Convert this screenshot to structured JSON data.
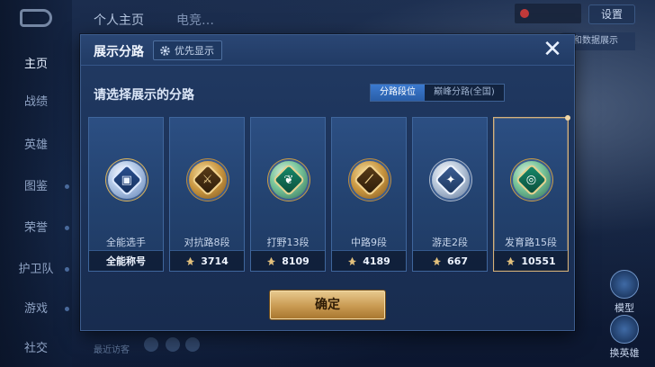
{
  "background": {
    "nav": {
      "items": [
        {
          "label": "主页",
          "active": true
        },
        {
          "label": "战绩",
          "active": false
        },
        {
          "label": "英雄",
          "active": false
        },
        {
          "label": "图鉴",
          "active": false
        },
        {
          "label": "荣誉",
          "active": false
        },
        {
          "label": "护卫队",
          "active": false
        },
        {
          "label": "游戏",
          "active": false
        },
        {
          "label": "社交",
          "active": false
        }
      ]
    },
    "top_tabs": [
      "个人主页",
      "电竞…"
    ],
    "settings_label": "设置",
    "data_tag": "和数据展示",
    "model_label": "模型",
    "switch_hero_label": "换英雄",
    "bottom_hint": "最近访客"
  },
  "modal": {
    "title": "展示分路",
    "priority_label": "优先显示",
    "close_glyph": "✕",
    "prompt": "请选择展示的分路",
    "segments": [
      {
        "label": "分路段位",
        "active": true
      },
      {
        "label": "巅峰分路(全国)",
        "active": false
      }
    ],
    "cards": [
      {
        "name": "全能选手",
        "footer": "全能称号",
        "emblem": "all-round-emblem-icon",
        "style": "blue",
        "glyph": "▣",
        "show_power": false,
        "selected": false
      },
      {
        "name": "对抗路8段",
        "footer": "3714",
        "emblem": "clash-lane-emblem-icon",
        "style": "gold",
        "glyph": "⚔",
        "show_power": true,
        "selected": false
      },
      {
        "name": "打野13段",
        "footer": "8109",
        "emblem": "jungle-emblem-icon",
        "style": "green",
        "glyph": "❦",
        "show_power": true,
        "selected": false
      },
      {
        "name": "中路9段",
        "footer": "4189",
        "emblem": "mid-lane-emblem-icon",
        "style": "gold",
        "glyph": "⟋",
        "show_power": true,
        "selected": false
      },
      {
        "name": "游走2段",
        "footer": "667",
        "emblem": "roam-emblem-icon",
        "style": "silver",
        "glyph": "✦",
        "show_power": true,
        "selected": false
      },
      {
        "name": "发育路15段",
        "footer": "10551",
        "emblem": "farm-lane-emblem-icon",
        "style": "green",
        "glyph": "◎",
        "show_power": true,
        "selected": true
      }
    ],
    "confirm_label": "确定"
  },
  "colors": {
    "accent_gold": "#d6b27a",
    "active_tab_blue": "#2a5ea8",
    "panel_bg": "#1b3157"
  }
}
